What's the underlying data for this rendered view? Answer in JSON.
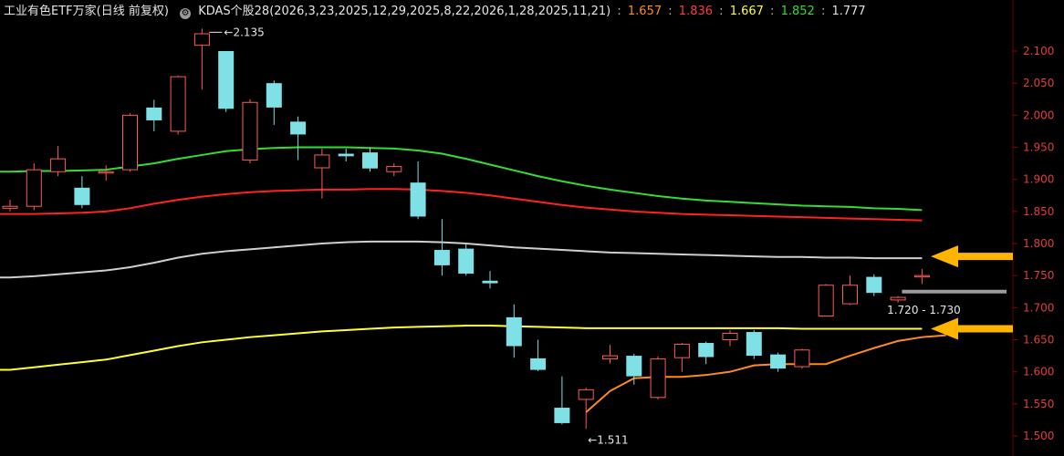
{
  "header": {
    "title": "工业有色ETF万家(日线 前复权)",
    "indicator_name": "KDAS个股28(2026,3,23,2025,12,29,2025,8,22,2026,1,28,2025,11,21)",
    "values": [
      {
        "text": "1.657",
        "color": "#ff8c1a"
      },
      {
        "text": "1.836",
        "color": "#ff3b3b"
      },
      {
        "text": "1.667",
        "color": "#ffff33"
      },
      {
        "text": "1.852",
        "color": "#33dd33"
      },
      {
        "text": "1.777",
        "color": "#e0e0e0"
      }
    ]
  },
  "chart_data": {
    "type": "candlestick",
    "title": "工业有色ETF万家(日线 前复权)",
    "ylim": [
      1.5,
      2.13
    ],
    "y_ticks": [
      "1.500",
      "1.550",
      "1.600",
      "1.650",
      "1.700",
      "1.750",
      "1.800",
      "1.850",
      "1.900",
      "1.950",
      "2.000",
      "2.050",
      "2.100"
    ],
    "colors": {
      "up": "#ff5a5a",
      "down": "#7fe0e6",
      "green": "#33dd33",
      "red": "#ff2222",
      "gray": "#cfcfcf",
      "yellow": "#ffff33",
      "orange": "#ff8c1a",
      "arrow": "#ffb400"
    },
    "candles": [
      {
        "o": 1.855,
        "h": 1.868,
        "l": 1.85,
        "c": 1.858
      },
      {
        "o": 1.858,
        "h": 1.925,
        "l": 1.852,
        "c": 1.915
      },
      {
        "o": 1.912,
        "h": 1.952,
        "l": 1.905,
        "c": 1.932
      },
      {
        "o": 1.887,
        "h": 1.905,
        "l": 1.855,
        "c": 1.86
      },
      {
        "o": 1.91,
        "h": 1.922,
        "l": 1.898,
        "c": 1.912
      },
      {
        "o": 1.915,
        "h": 2.003,
        "l": 1.912,
        "c": 2.0
      },
      {
        "o": 2.012,
        "h": 2.024,
        "l": 1.975,
        "c": 1.992
      },
      {
        "o": 1.975,
        "h": 2.062,
        "l": 1.97,
        "c": 2.06
      },
      {
        "o": 2.109,
        "h": 2.135,
        "l": 2.04,
        "c": 2.127
      },
      {
        "o": 2.1,
        "h": 2.1,
        "l": 2.005,
        "c": 2.01
      },
      {
        "o": 1.93,
        "h": 2.025,
        "l": 1.925,
        "c": 2.02
      },
      {
        "o": 2.05,
        "h": 2.054,
        "l": 1.985,
        "c": 2.012
      },
      {
        "o": 1.99,
        "h": 1.998,
        "l": 1.93,
        "c": 1.97
      },
      {
        "o": 1.918,
        "h": 1.948,
        "l": 1.87,
        "c": 1.938
      },
      {
        "o": 1.94,
        "h": 1.948,
        "l": 1.928,
        "c": 1.936
      },
      {
        "o": 1.942,
        "h": 1.95,
        "l": 1.912,
        "c": 1.917
      },
      {
        "o": 1.912,
        "h": 1.925,
        "l": 1.905,
        "c": 1.92
      },
      {
        "o": 1.895,
        "h": 1.928,
        "l": 1.838,
        "c": 1.842
      },
      {
        "o": 1.79,
        "h": 1.838,
        "l": 1.75,
        "c": 1.766
      },
      {
        "o": 1.792,
        "h": 1.8,
        "l": 1.75,
        "c": 1.753
      },
      {
        "o": 1.742,
        "h": 1.757,
        "l": 1.73,
        "c": 1.738
      },
      {
        "o": 1.685,
        "h": 1.705,
        "l": 1.622,
        "c": 1.64
      },
      {
        "o": 1.621,
        "h": 1.65,
        "l": 1.601,
        "c": 1.603
      },
      {
        "o": 1.544,
        "h": 1.593,
        "l": 1.518,
        "c": 1.52
      },
      {
        "o": 1.557,
        "h": 1.575,
        "l": 1.511,
        "c": 1.572
      },
      {
        "o": 1.62,
        "h": 1.642,
        "l": 1.613,
        "c": 1.625
      },
      {
        "o": 1.625,
        "h": 1.628,
        "l": 1.58,
        "c": 1.593
      },
      {
        "o": 1.56,
        "h": 1.624,
        "l": 1.557,
        "c": 1.62
      },
      {
        "o": 1.622,
        "h": 1.645,
        "l": 1.6,
        "c": 1.643
      },
      {
        "o": 1.645,
        "h": 1.647,
        "l": 1.612,
        "c": 1.623
      },
      {
        "o": 1.65,
        "h": 1.665,
        "l": 1.64,
        "c": 1.66
      },
      {
        "o": 1.662,
        "h": 1.665,
        "l": 1.62,
        "c": 1.625
      },
      {
        "o": 1.627,
        "h": 1.63,
        "l": 1.6,
        "c": 1.605
      },
      {
        "o": 1.608,
        "h": 1.636,
        "l": 1.605,
        "c": 1.634
      },
      {
        "o": 1.687,
        "h": 1.737,
        "l": 1.687,
        "c": 1.735
      },
      {
        "o": 1.706,
        "h": 1.75,
        "l": 1.704,
        "c": 1.735
      },
      {
        "o": 1.748,
        "h": 1.752,
        "l": 1.718,
        "c": 1.723
      },
      {
        "o": 1.712,
        "h": 1.718,
        "l": 1.708,
        "c": 1.716
      },
      {
        "o": 1.748,
        "h": 1.76,
        "l": 1.737,
        "c": 1.75
      }
    ],
    "series": [
      {
        "color": "#33dd33",
        "start_index": 0,
        "values": [
          1.912,
          1.913,
          1.913,
          1.914,
          1.915,
          1.92,
          1.925,
          1.932,
          1.938,
          1.944,
          1.947,
          1.949,
          1.95,
          1.95,
          1.95,
          1.949,
          1.948,
          1.945,
          1.94,
          1.932,
          1.923,
          1.914,
          1.905,
          1.897,
          1.89,
          1.884,
          1.879,
          1.874,
          1.87,
          1.867,
          1.865,
          1.863,
          1.861,
          1.859,
          1.858,
          1.857,
          1.855,
          1.854,
          1.852
        ]
      },
      {
        "color": "#ff2222",
        "start_index": 0,
        "values": [
          1.846,
          1.846,
          1.847,
          1.848,
          1.85,
          1.855,
          1.862,
          1.868,
          1.873,
          1.877,
          1.88,
          1.882,
          1.883,
          1.884,
          1.884,
          1.885,
          1.885,
          1.884,
          1.882,
          1.879,
          1.875,
          1.87,
          1.865,
          1.86,
          1.856,
          1.853,
          1.85,
          1.848,
          1.846,
          1.845,
          1.844,
          1.843,
          1.842,
          1.841,
          1.84,
          1.839,
          1.838,
          1.837,
          1.836
        ]
      },
      {
        "color": "#cfcfcf",
        "start_index": 0,
        "values": [
          1.747,
          1.749,
          1.752,
          1.755,
          1.758,
          1.763,
          1.77,
          1.778,
          1.784,
          1.788,
          1.791,
          1.794,
          1.797,
          1.8,
          1.802,
          1.803,
          1.803,
          1.803,
          1.802,
          1.8,
          1.797,
          1.794,
          1.792,
          1.79,
          1.788,
          1.786,
          1.785,
          1.784,
          1.783,
          1.782,
          1.781,
          1.78,
          1.779,
          1.779,
          1.778,
          1.778,
          1.777,
          1.777,
          1.777
        ]
      },
      {
        "color": "#ffff33",
        "start_index": 0,
        "values": [
          1.603,
          1.607,
          1.611,
          1.615,
          1.619,
          1.626,
          1.633,
          1.64,
          1.646,
          1.65,
          1.654,
          1.657,
          1.66,
          1.663,
          1.665,
          1.667,
          1.669,
          1.67,
          1.671,
          1.672,
          1.672,
          1.671,
          1.67,
          1.669,
          1.668,
          1.668,
          1.668,
          1.668,
          1.668,
          1.668,
          1.668,
          1.668,
          1.668,
          1.667,
          1.667,
          1.667,
          1.667,
          1.667,
          1.667
        ]
      },
      {
        "color": "#ff8c1a",
        "start_index": 24,
        "values": [
          1.537,
          1.57,
          1.59,
          1.592,
          1.592,
          1.595,
          1.6,
          1.61,
          1.612,
          1.612,
          1.612,
          1.625,
          1.637,
          1.648,
          1.654,
          1.657
        ]
      }
    ],
    "hline": {
      "y": 1.725,
      "color": "#9c9c9c"
    },
    "annotations": {
      "high": "2.135",
      "low": "1.511",
      "range": "1.720 - 1.730"
    },
    "arrows": [
      {
        "y": 1.78
      },
      {
        "y": 1.667
      }
    ]
  }
}
